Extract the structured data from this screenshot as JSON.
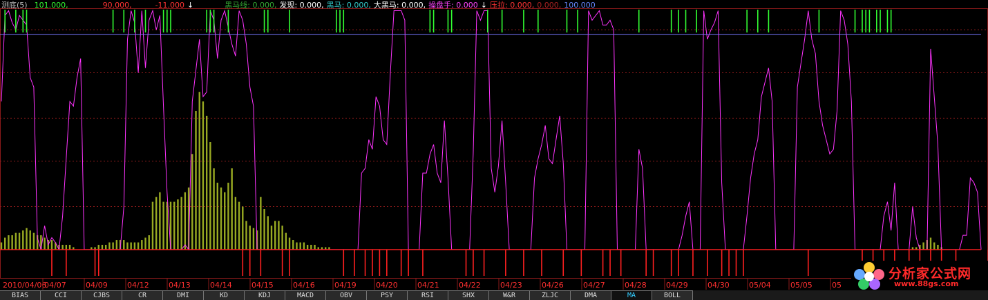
{
  "header": {
    "items": [
      {
        "text": "测底(5)",
        "color": "#c0c0c0"
      },
      {
        "text": "101.000,",
        "color": "#33ff33"
      },
      {
        "text": "90.000,",
        "color": "#ff3333"
      },
      {
        "text": "-11.000",
        "color": "#ff3333"
      },
      {
        "text": "↓",
        "color": "#ffffff"
      },
      {
        "text": "黑马线: 0.000,",
        "color": "#33aa33"
      },
      {
        "text": "发现: 0.000,",
        "color": "#ffffff"
      },
      {
        "text": "黑马: 0.000,",
        "color": "#33cccc"
      },
      {
        "text": "大黑马: 0.000,",
        "color": "#ffffff"
      },
      {
        "text": "操盘手: 0.000",
        "color": "#ff44ff"
      },
      {
        "text": "↓",
        "color": "#ffffff"
      },
      {
        "text": "压拉: 0.000,",
        "color": "#ff3333"
      },
      {
        "text": "0.000,",
        "color": "#aa2222"
      },
      {
        "text": "100.000",
        "color": "#6688ff"
      }
    ]
  },
  "colors": {
    "magenta": "#ff33ff",
    "olive": "#99aa22",
    "green": "#33ff33",
    "red": "#ff2020",
    "blue_line": "#7777ff",
    "grid": "#8b1a1a"
  },
  "chart_data": {
    "type": "line",
    "ylim": [
      -11,
      101
    ],
    "reference_lines": [
      90,
      0
    ],
    "x_labels": [
      "2010/04/06",
      "04/07",
      "04/09",
      "04/12",
      "04/13",
      "04/14",
      "04/15",
      "04/16",
      "04/19",
      "04/20",
      "04/21",
      "04/22",
      "04/23",
      "04/26",
      "04/27",
      "04/28",
      "04/29",
      "04/30",
      "05/04",
      "05/05",
      "05"
    ],
    "series": [
      {
        "style": "line",
        "color": "#ff33ff",
        "values": [
          62,
          98,
          100,
          95,
          92,
          98,
          96,
          94,
          72,
          68,
          5,
          0,
          10,
          2,
          5,
          3,
          0,
          14,
          38,
          62,
          60,
          72,
          80,
          0,
          0,
          0,
          0,
          0,
          0,
          0,
          0,
          0,
          0,
          0,
          18,
          88,
          100,
          95,
          74,
          100,
          76,
          96,
          100,
          92,
          98,
          60,
          24,
          0,
          0,
          0,
          0,
          2,
          0,
          62,
          75,
          88,
          64,
          66,
          100,
          96,
          80,
          96,
          100,
          93,
          86,
          81,
          100,
          96,
          86,
          68,
          60,
          0,
          0,
          0,
          0,
          0,
          0,
          0,
          0,
          0,
          0,
          0,
          0,
          0,
          0,
          0,
          0,
          0,
          0,
          0,
          0,
          0,
          0,
          0,
          0,
          0,
          0,
          0,
          0,
          0,
          32,
          34,
          46,
          42,
          64,
          60,
          46,
          44,
          74,
          100,
          100,
          100,
          96,
          0,
          0,
          0,
          0,
          32,
          32,
          40,
          44,
          32,
          28,
          54,
          30,
          0,
          0,
          0,
          0,
          0,
          0,
          40,
          100,
          96,
          100,
          100,
          34,
          24,
          35,
          54,
          28,
          0,
          0,
          0,
          0,
          0,
          0,
          0,
          30,
          38,
          44,
          52,
          38,
          36,
          46,
          56,
          36,
          0,
          0,
          0,
          0,
          0,
          0,
          100,
          96,
          98,
          100,
          94,
          94,
          96,
          92,
          0,
          0,
          0,
          0,
          0,
          0,
          42,
          34,
          0,
          0,
          0,
          0,
          0,
          0,
          0,
          0,
          0,
          0,
          6,
          14,
          20,
          0,
          0,
          0,
          100,
          88,
          92,
          95,
          100,
          28,
          0,
          0,
          0,
          0,
          0,
          0,
          14,
          30,
          40,
          46,
          64,
          70,
          76,
          62,
          0,
          0,
          0,
          0,
          0,
          0,
          68,
          78,
          88,
          100,
          88,
          82,
          62,
          52,
          46,
          40,
          42,
          58,
          100,
          96,
          86,
          62,
          0,
          0,
          0,
          0,
          0,
          0,
          0,
          0,
          14,
          20,
          8,
          28,
          0,
          0,
          0,
          0,
          18,
          5,
          0,
          0,
          0,
          84,
          64,
          44,
          0,
          0,
          0,
          0,
          0,
          0,
          6,
          6,
          30,
          28,
          24,
          0
        ]
      },
      {
        "style": "bar",
        "color": "#99aa22",
        "values": [
          3,
          5,
          6,
          6,
          7,
          7,
          8,
          9,
          8,
          7,
          6,
          6,
          5,
          4,
          4,
          3,
          2,
          2,
          2,
          2,
          1,
          0,
          0,
          0,
          0,
          1,
          1,
          2,
          2,
          2,
          3,
          3,
          4,
          4,
          4,
          3,
          3,
          3,
          3,
          4,
          5,
          6,
          20,
          22,
          24,
          20,
          20,
          20,
          20,
          21,
          22,
          24,
          26,
          40,
          58,
          66,
          62,
          56,
          45,
          34,
          28,
          26,
          24,
          28,
          34,
          22,
          20,
          18,
          12,
          10,
          9,
          8,
          22,
          17,
          14,
          10,
          12,
          12,
          10,
          7,
          5,
          4,
          3,
          3,
          3,
          2,
          2,
          2,
          1,
          1,
          1,
          1,
          0,
          0,
          0,
          0,
          0,
          0,
          0,
          0,
          0,
          0,
          0,
          0,
          0,
          0,
          0,
          0,
          0,
          0,
          0,
          0,
          0,
          0,
          0,
          0,
          0,
          0,
          0,
          0,
          0,
          0,
          0,
          0,
          0,
          0,
          0,
          0,
          0,
          0,
          0,
          0,
          0,
          0,
          0,
          0,
          0,
          0,
          0,
          0,
          0,
          0,
          0,
          0,
          0,
          0,
          0,
          0,
          0,
          0,
          0,
          0,
          0,
          0,
          0,
          0,
          0,
          0,
          0,
          0,
          0,
          0,
          0,
          0,
          0,
          0,
          0,
          0,
          0,
          0,
          0,
          0,
          0,
          0,
          0,
          0,
          0,
          0,
          0,
          0,
          0,
          0,
          0,
          0,
          0,
          0,
          0,
          0,
          0,
          0,
          0,
          0,
          0,
          0,
          0,
          0,
          0,
          0,
          0,
          0,
          0,
          0,
          0,
          0,
          0,
          0,
          0,
          0,
          0,
          0,
          0,
          0,
          0,
          0,
          0,
          0,
          0,
          0,
          0,
          0,
          0,
          0,
          0,
          0,
          0,
          0,
          0,
          0,
          0,
          0,
          0,
          0,
          0,
          0,
          0,
          0,
          0,
          0,
          0,
          0,
          0,
          0,
          0,
          0,
          0,
          0,
          0,
          0,
          0,
          0,
          0,
          0,
          0,
          1,
          1,
          2,
          3,
          4,
          5,
          3,
          2,
          1,
          0,
          0,
          0,
          0,
          0,
          0,
          0,
          0,
          0,
          0,
          0,
          0,
          0,
          0,
          0,
          0,
          0,
          0,
          0,
          0,
          0,
          0,
          0,
          0,
          0,
          0,
          0,
          0,
          0,
          0,
          0,
          0
        ]
      }
    ],
    "green_marks_x_index": [
      1,
      4,
      6,
      7,
      31,
      34,
      37,
      40,
      45,
      46,
      47,
      57,
      58,
      59,
      63,
      73,
      74,
      80,
      93,
      94,
      95,
      119,
      120,
      124,
      125,
      135,
      139,
      145,
      149,
      157,
      160,
      177,
      186,
      188,
      190,
      193,
      207,
      210,
      213,
      227,
      237,
      239,
      240,
      241,
      243,
      244,
      246,
      247
    ],
    "red_marks_x_index": [
      14,
      18,
      26,
      27,
      67,
      69,
      72,
      78,
      80,
      95,
      98,
      101,
      103,
      105,
      107,
      111,
      113,
      117,
      129,
      131,
      134,
      140,
      145,
      150,
      156,
      161,
      167,
      169,
      172,
      179,
      181,
      186,
      188,
      192,
      196,
      200,
      202,
      204,
      206,
      224,
      239,
      242,
      245,
      248,
      252,
      255,
      258,
      261,
      265,
      274
    ]
  },
  "tabs": {
    "items": [
      "BIAS",
      "CCI",
      "CJBS",
      "CR",
      "DMI",
      "KD",
      "KDJ",
      "MACD",
      "OBV",
      "PSY",
      "RSI",
      "SHX",
      "W&R",
      "ZLJC",
      "DMA",
      "MA",
      "BOLL"
    ],
    "active": "MA"
  },
  "logo": {
    "name": "分析家公式网",
    "url": "www.88gs.com"
  }
}
